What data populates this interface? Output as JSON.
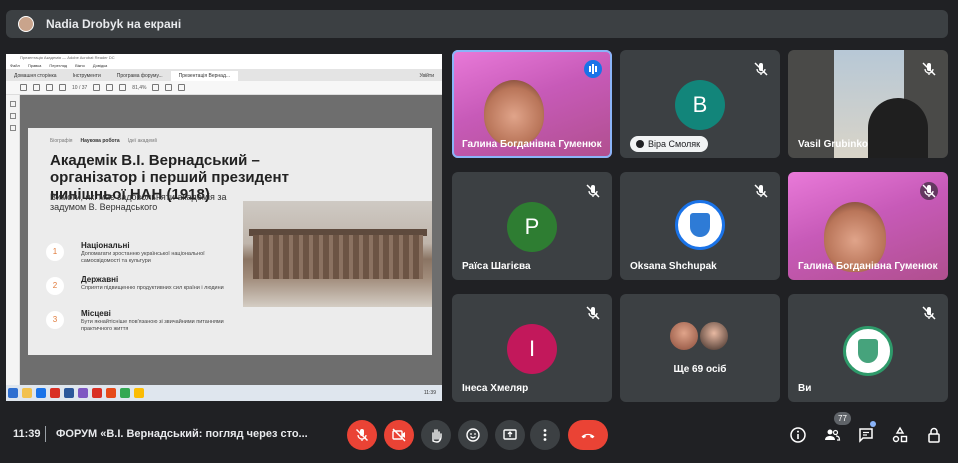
{
  "presenter_bar": {
    "text": "Nadia Drobyk на екрані"
  },
  "shared_screen": {
    "window_title": "Презентація Академія — Adobe Acrobat Reader DC",
    "menu": [
      "Файл",
      "Правка",
      "Перегляд",
      "Вікно",
      "Довідка"
    ],
    "tabs": [
      "Домашня сторінка",
      "Інструменти",
      "Програма форуму...",
      "Презентація Вернад..."
    ],
    "user_button": "Увійти",
    "page_box": "10 / 37",
    "zoom": "81,4%",
    "slide": {
      "nav": [
        "Біографія",
        "Наукова робота",
        "Ідеї академії"
      ],
      "title": "Академік В.І. Вернадський – організатор і перший президент нинішньої НАН (1918)",
      "subtitle": "Вимоги, які має задовольняти академія за задумом В. Вернадського",
      "items": [
        {
          "num": "1",
          "title": "Національні",
          "desc": "Допомагати зростанню української національної самосвідомості та культури"
        },
        {
          "num": "2",
          "title": "Державні",
          "desc": "Сприяти підвищенню продуктивних сил країни і людини"
        },
        {
          "num": "3",
          "title": "Місцеві",
          "desc": "Бути якнайтісніше пов'язаною зі звичайними питаннями практичного життя"
        }
      ]
    },
    "taskbar_time": "11:39"
  },
  "tiles": [
    {
      "name": "Галина Богданівна Гуменюк",
      "kind": "video",
      "speaking": true
    },
    {
      "name": "Віра Смоляк",
      "kind": "avatar",
      "initial": "B",
      "color": "#12857a"
    },
    {
      "name": "Vasil Grubinko",
      "kind": "video"
    },
    {
      "name": "Раїса Шагієва",
      "kind": "avatar",
      "initial": "P",
      "color": "#2e7d32"
    },
    {
      "name": "Oksana Shchupak",
      "kind": "logo"
    },
    {
      "name": "Галина Богданівна Гуменюк",
      "kind": "video"
    },
    {
      "name": "Інеса Хмеляр",
      "kind": "avatar",
      "initial": "I",
      "color": "#c2185b"
    },
    {
      "name": "Ще 69 осіб",
      "kind": "more"
    },
    {
      "name": "Ви",
      "kind": "logo"
    }
  ],
  "bottom": {
    "time": "11:39",
    "meeting_title": "ФОРУМ «В.І. Вернадський: погляд через сто...",
    "participants_count": "77"
  },
  "colors": {
    "background": "#202124",
    "tile": "#3c4043",
    "danger": "#ea4335",
    "accent": "#8ab4f8"
  },
  "icons": {
    "controls": [
      "mic-off-icon",
      "camera-off-icon",
      "raise-hand-icon",
      "emoji-icon",
      "present-icon",
      "more-options-icon",
      "end-call-icon"
    ],
    "right": [
      "info-icon",
      "people-icon",
      "chat-icon",
      "activities-icon",
      "lock-icon"
    ]
  }
}
